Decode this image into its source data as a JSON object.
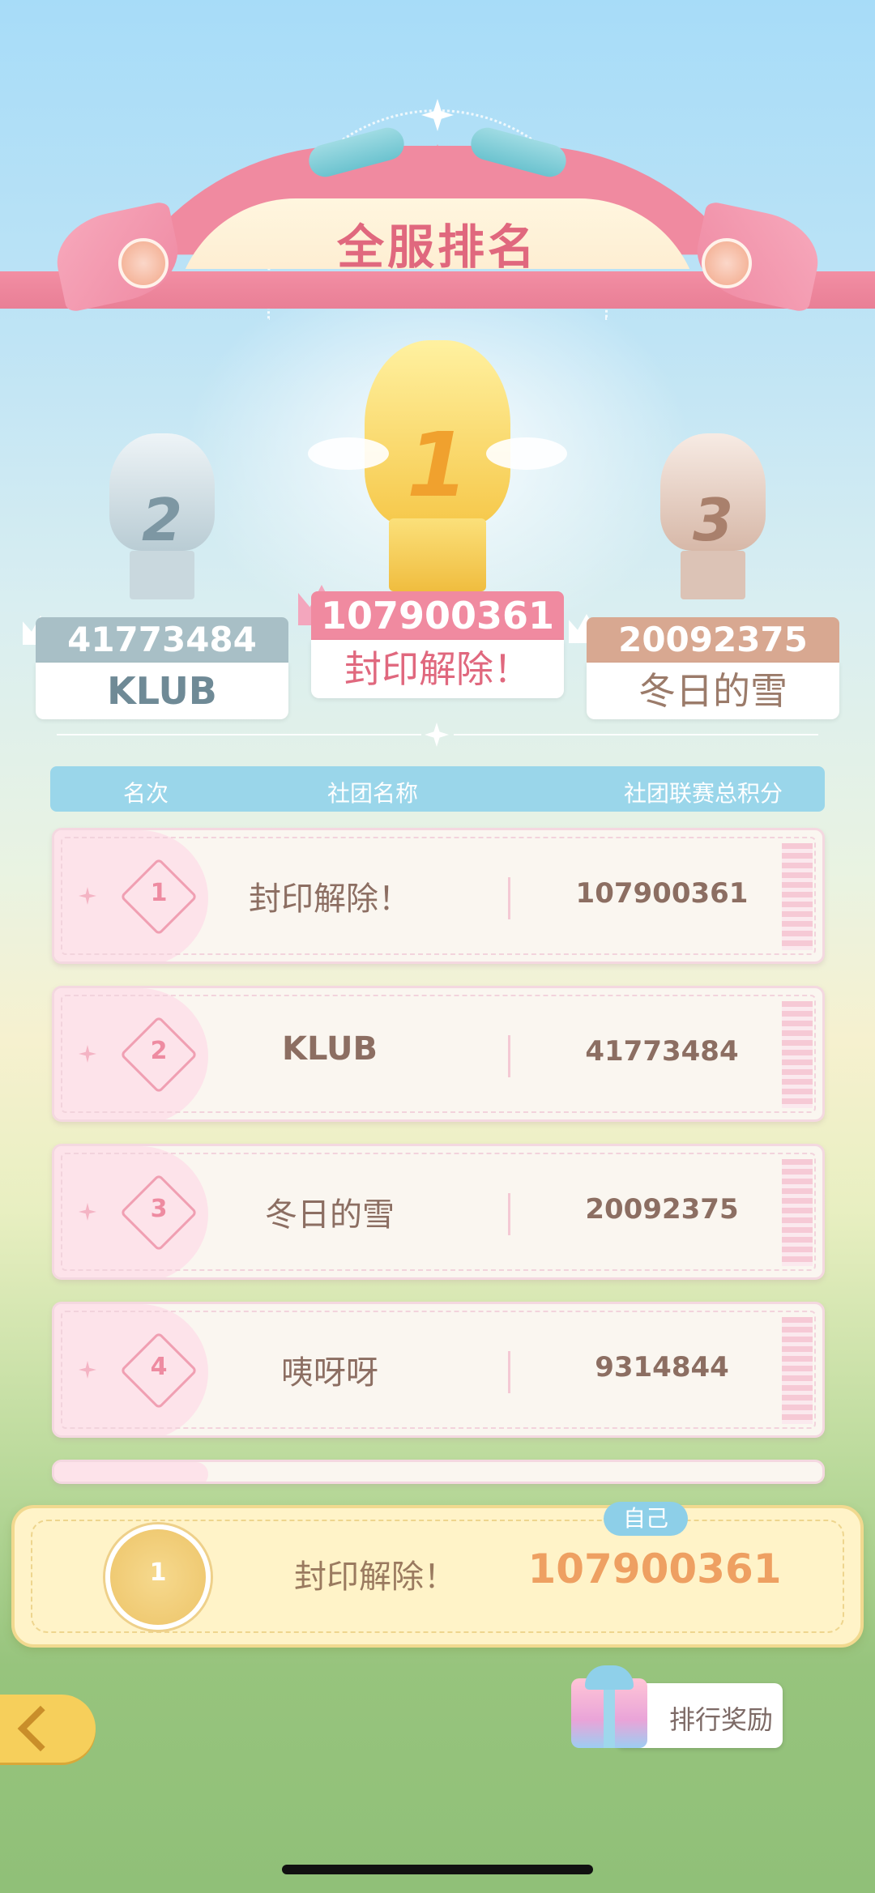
{
  "banner": {
    "title": "全服排名"
  },
  "podium": [
    {
      "rank_digit": "2",
      "score": "41773484",
      "name": "KLUB"
    },
    {
      "rank_digit": "1",
      "score": "107900361",
      "name": "封印解除！"
    },
    {
      "rank_digit": "3",
      "score": "20092375",
      "name": "冬日的雪"
    }
  ],
  "table": {
    "headers": {
      "rank": "名次",
      "club_name": "社团名称",
      "total_score": "社团联赛总积分"
    },
    "rows": [
      {
        "rank": "1",
        "name": "封印解除！",
        "score": "107900361"
      },
      {
        "rank": "2",
        "name": "KLUB",
        "score": "41773484"
      },
      {
        "rank": "3",
        "name": "冬日的雪",
        "score": "20092375"
      },
      {
        "rank": "4",
        "name": "咦呀呀",
        "score": "9314844"
      }
    ]
  },
  "self": {
    "tag": "自己",
    "rank": "1",
    "name": "封印解除！",
    "score": "107900361"
  },
  "buttons": {
    "reward_label": "排行奖励"
  },
  "colors": {
    "gold": "#f6cf5b",
    "silver": "#a8bfc6",
    "bronze": "#d8a891",
    "pink": "#ee8ba1",
    "sky": "#9ad6ea"
  },
  "icons": {
    "back": "back-arrow-icon",
    "gift": "gift-icon",
    "crown": "crown-icon"
  }
}
